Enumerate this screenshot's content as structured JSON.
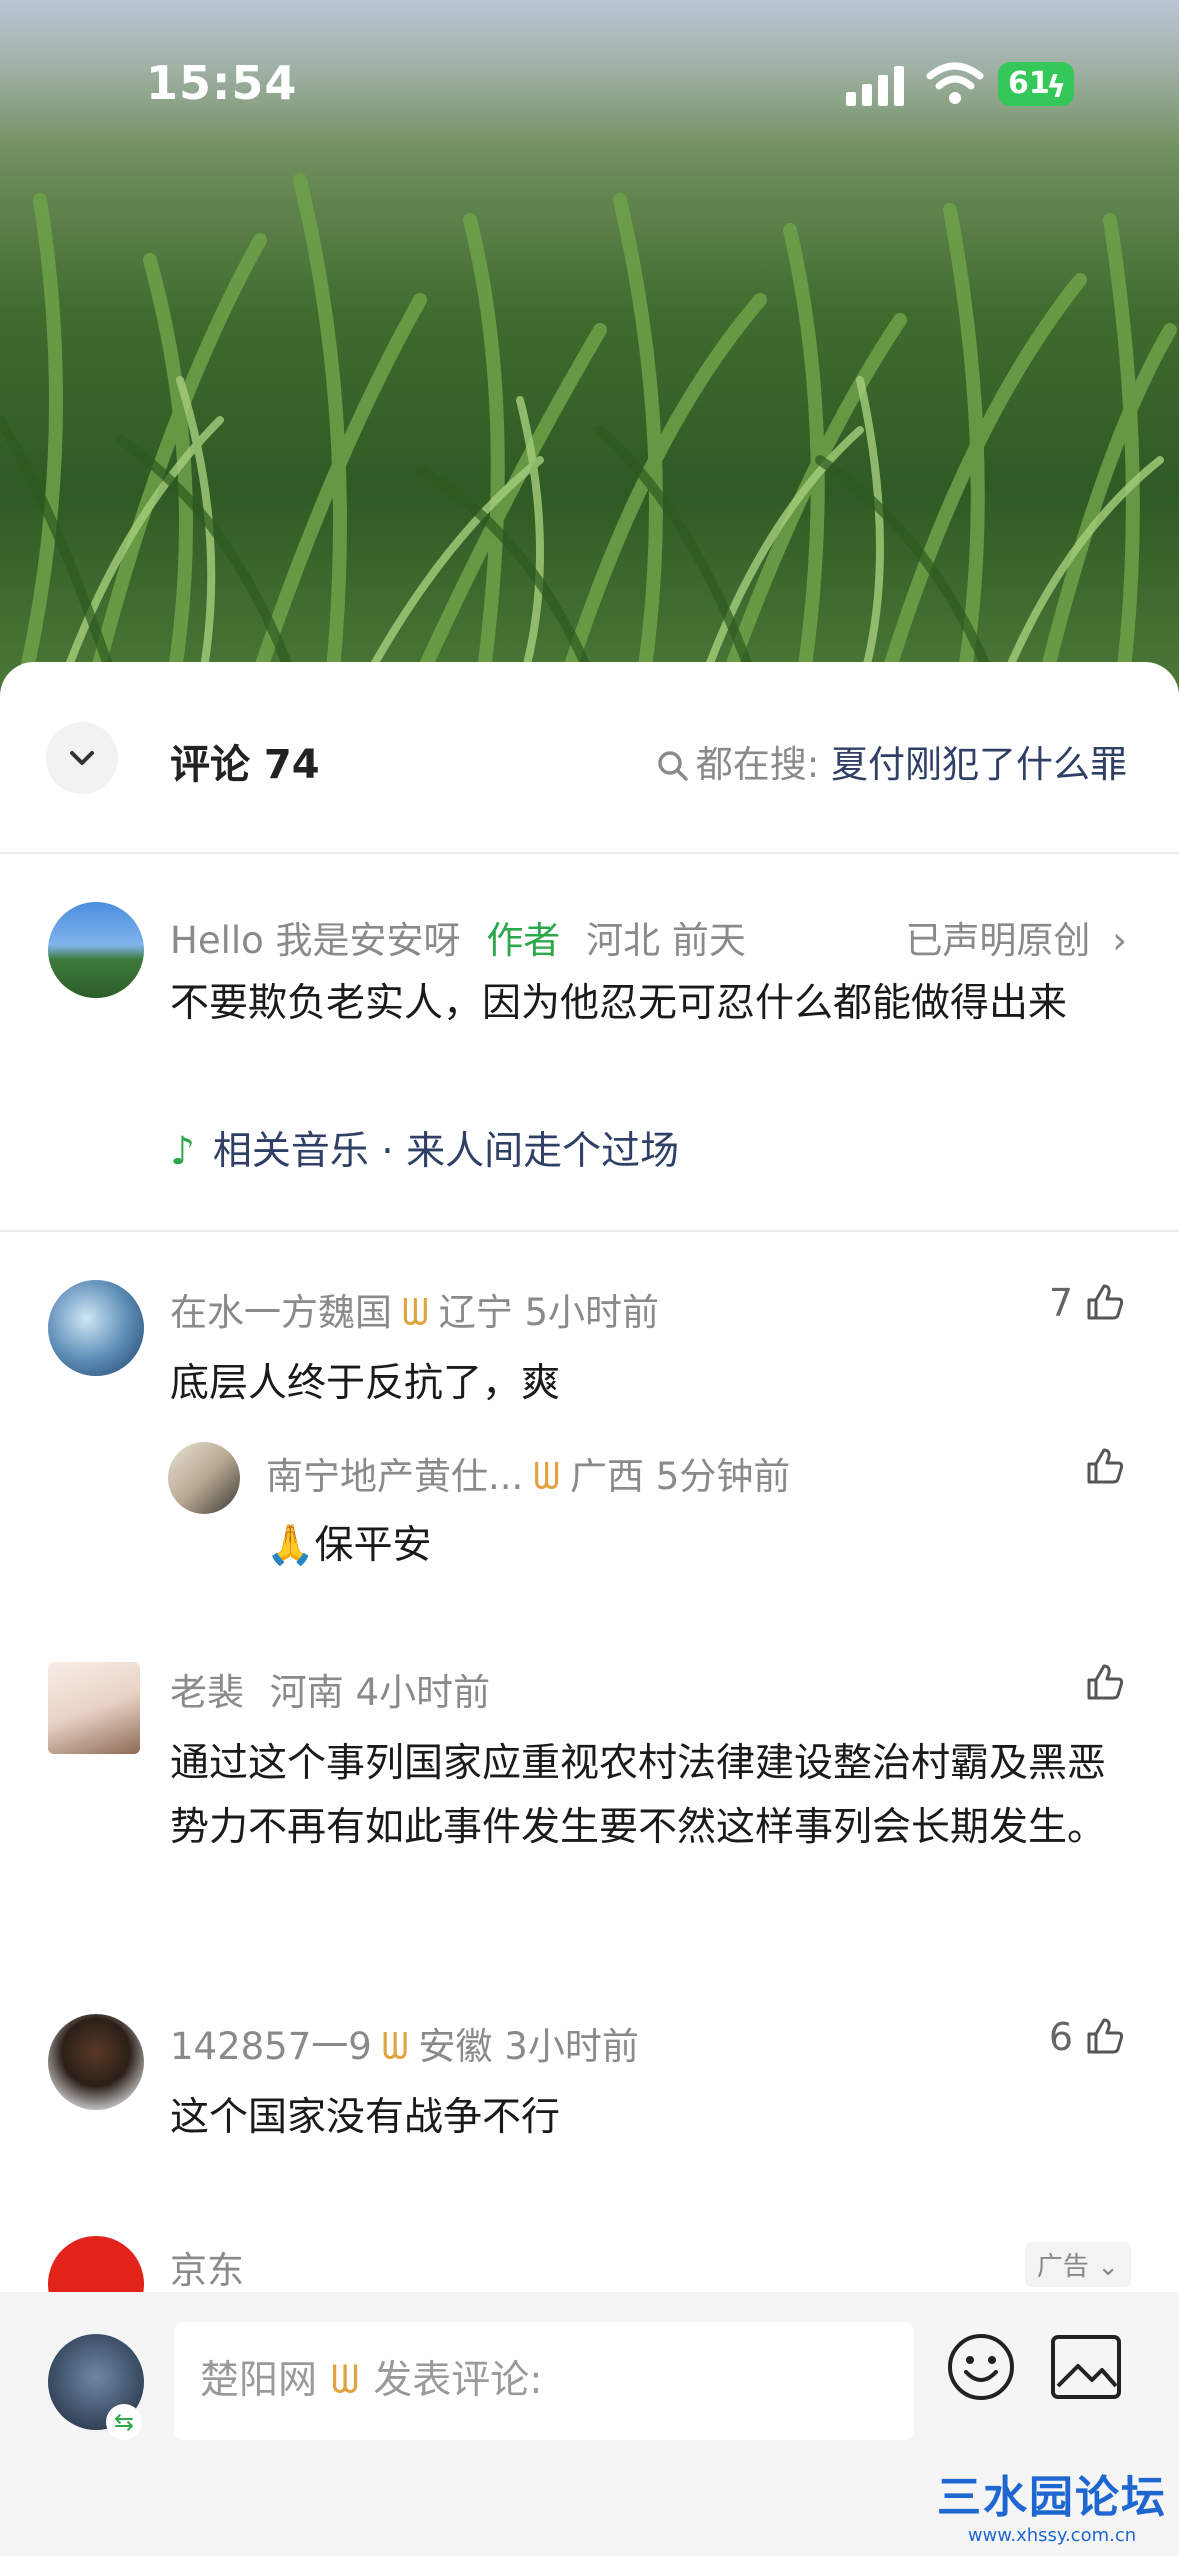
{
  "status_bar": {
    "time": "15:54",
    "battery": "61"
  },
  "header": {
    "comments_title": "评论 74",
    "search_prefix": "都在搜:",
    "search_query": "夏付刚犯了什么罪"
  },
  "author_post": {
    "username": "Hello 我是安安呀",
    "author_tag": "作者",
    "location_time": "河北 前天",
    "original_label": "已声明原创",
    "text": "不要欺负老实人，因为他忍无可忍什么都能做得出来",
    "music": "相关音乐 · 来人间走个过场"
  },
  "comments": [
    {
      "username": "在水一方魏国",
      "vip": "ᗯ",
      "location_time": "辽宁 5小时前",
      "likes": "7",
      "text": "底层人终于反抗了，爽",
      "reply": {
        "username": "南宁地产黄仕...",
        "vip": "ᗯ",
        "location_time": "广西 5分钟前",
        "text": "🙏保平安"
      }
    },
    {
      "username": "老裴",
      "location_time": "河南 4小时前",
      "likes": "",
      "text": "通过这个事列国家应重视农村法律建设整治村霸及黑恶势力不再有如此事件发生要不然这样事列会长期发生。"
    },
    {
      "username": "142857一9",
      "vip": "ᗯ",
      "location_time": "安徽 3小时前",
      "likes": "6",
      "text": "这个国家没有战争不行"
    },
    {
      "username": "京东",
      "ad_label": "广告"
    }
  ],
  "composer": {
    "user": "楚阳网",
    "vip": "ᗯ",
    "placeholder": "发表评论:"
  },
  "watermark": {
    "title": "三水园论坛",
    "url": "www.xhssy.com.cn"
  },
  "colors": {
    "accent_green": "#2aa84a",
    "vip_gold": "#e0a340",
    "link_blue": "#2f3f66"
  }
}
